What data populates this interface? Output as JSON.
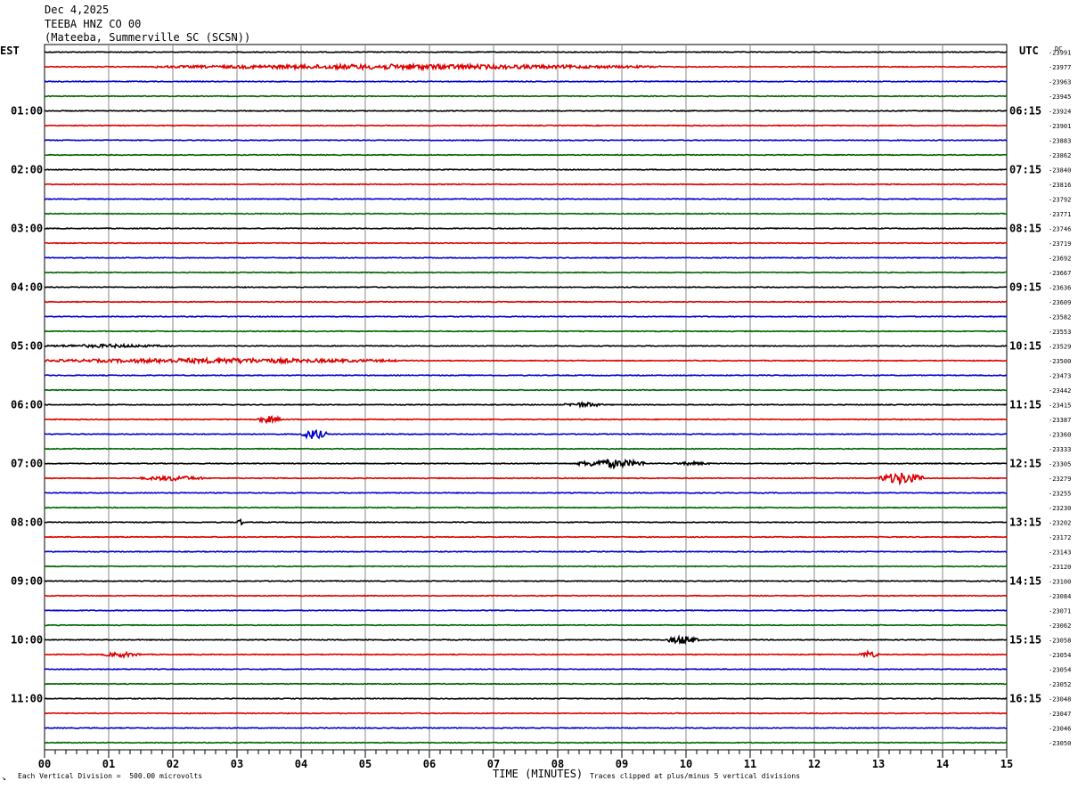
{
  "header": {
    "date": "Dec 4,2025",
    "station": "TEEBA HNZ CO 00",
    "location": "(Mateeba, Summerville SC (SCSN))"
  },
  "left_zone_label": "EST",
  "right_zone_label": "UTC",
  "dc_label": "DC",
  "footer": {
    "xlabel": "TIME (MINUTES)",
    "scale_note": "Each Vertical Division =  500.00 microvolts",
    "clip_note": "Traces clipped at plus/minus 5 vertical divisions",
    "corner_mark": "↘"
  },
  "colors": {
    "trace_cycle": [
      "#000000",
      "#dd0000",
      "#0000cc",
      "#006600"
    ],
    "grid": "#888888"
  },
  "chart_data": {
    "type": "line",
    "title": "TEEBA HNZ CO 00",
    "xlabel": "TIME (MINUTES)",
    "xlim": [
      0,
      15
    ],
    "x_ticks": [
      "00",
      "01",
      "02",
      "03",
      "04",
      "05",
      "06",
      "07",
      "08",
      "09",
      "10",
      "11",
      "12",
      "13",
      "14",
      "15"
    ],
    "rows_per_hour": 4,
    "row_count": 48,
    "left_hour_labels": [
      "01:00",
      "02:00",
      "03:00",
      "04:00",
      "05:00",
      "06:00",
      "07:00",
      "08:00",
      "09:00",
      "10:00",
      "11:00"
    ],
    "right_hour_labels": [
      "06:15",
      "07:15",
      "08:15",
      "09:15",
      "10:15",
      "11:15",
      "12:15",
      "13:15",
      "14:15",
      "15:15",
      "16:15"
    ],
    "dc_offsets": [
      -23991,
      -23977,
      -23963,
      -23945,
      -23924,
      -23901,
      -23883,
      -23862,
      -23840,
      -23816,
      -23792,
      -23771,
      -23746,
      -23719,
      -23692,
      -23667,
      -23636,
      -23609,
      -23582,
      -23553,
      -23529,
      -23500,
      -23473,
      -23442,
      -23415,
      -23387,
      -23360,
      -23333,
      -23305,
      -23279,
      -23255,
      -23230,
      -23202,
      -23172,
      -23143,
      -23120,
      -23100,
      -23084,
      -23071,
      -23062,
      -23058,
      -23054,
      -23054,
      -23052,
      -23048,
      -23047,
      -23046,
      -23050
    ],
    "events": [
      {
        "row": 1,
        "start": 1.7,
        "end": 9.6,
        "amp": 3
      },
      {
        "row": 20,
        "start": 0,
        "end": 2.0,
        "amp": 2
      },
      {
        "row": 21,
        "start": 0,
        "end": 5.5,
        "amp": 3
      },
      {
        "row": 24,
        "start": 8.1,
        "end": 8.7,
        "amp": 3
      },
      {
        "row": 25,
        "start": 3.3,
        "end": 3.7,
        "amp": 4
      },
      {
        "row": 26,
        "start": 4.0,
        "end": 4.4,
        "amp": 6
      },
      {
        "row": 28,
        "start": 8.3,
        "end": 9.4,
        "amp": 5
      },
      {
        "row": 28,
        "start": 9.8,
        "end": 10.4,
        "amp": 2
      },
      {
        "row": 29,
        "start": 1.5,
        "end": 2.5,
        "amp": 3
      },
      {
        "row": 29,
        "start": 13.0,
        "end": 13.7,
        "amp": 7
      },
      {
        "row": 32,
        "start": 3.0,
        "end": 3.1,
        "amp": 4
      },
      {
        "row": 40,
        "start": 9.7,
        "end": 10.2,
        "amp": 5
      },
      {
        "row": 41,
        "start": 0.9,
        "end": 1.5,
        "amp": 3
      },
      {
        "row": 41,
        "start": 12.7,
        "end": 13.0,
        "amp": 4
      }
    ]
  }
}
